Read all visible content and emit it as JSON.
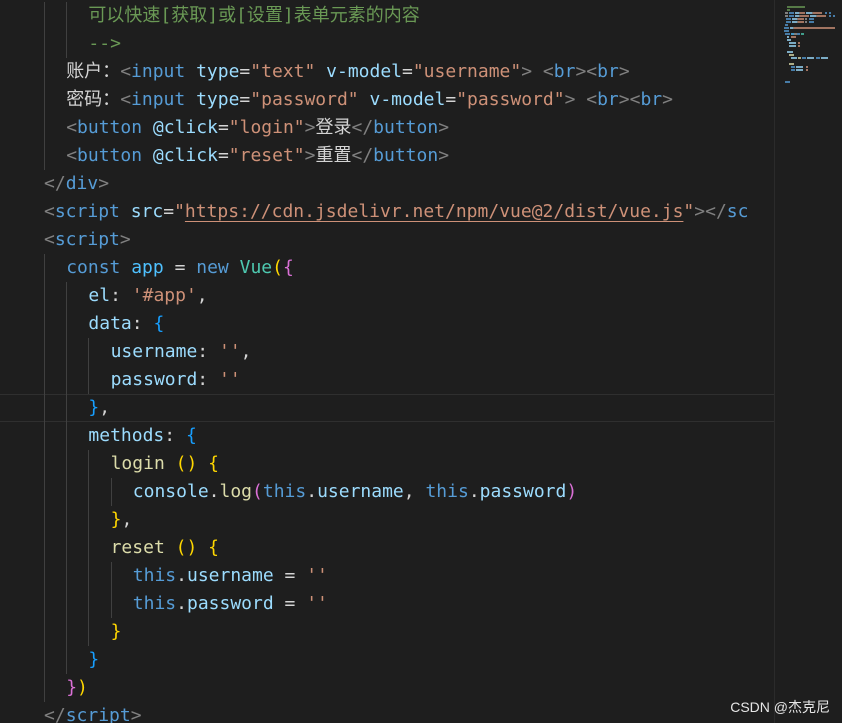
{
  "editor": {
    "current_line_index": 14,
    "lines": [
      {
        "indent": 2,
        "tokens": [
          [
            "comment",
            "可以快速[获取]或[设置]表单元素的内容"
          ]
        ]
      },
      {
        "indent": 2,
        "tokens": [
          [
            "comment",
            "-->"
          ]
        ]
      },
      {
        "indent": 1,
        "tokens": [
          [
            "text",
            "账户："
          ],
          [
            "bracket",
            "<"
          ],
          [
            "tag",
            "input"
          ],
          [
            "text",
            " "
          ],
          [
            "attr",
            "type"
          ],
          [
            "text",
            "="
          ],
          [
            "str",
            "\"text\""
          ],
          [
            "text",
            " "
          ],
          [
            "attr",
            "v-model"
          ],
          [
            "text",
            "="
          ],
          [
            "str",
            "\"username\""
          ],
          [
            "bracket",
            ">"
          ],
          [
            "text",
            " "
          ],
          [
            "bracket",
            "<"
          ],
          [
            "tag",
            "br"
          ],
          [
            "bracket",
            "><"
          ],
          [
            "tag",
            "br"
          ],
          [
            "bracket",
            ">"
          ]
        ]
      },
      {
        "indent": 1,
        "tokens": [
          [
            "text",
            "密码："
          ],
          [
            "bracket",
            "<"
          ],
          [
            "tag",
            "input"
          ],
          [
            "text",
            " "
          ],
          [
            "attr",
            "type"
          ],
          [
            "text",
            "="
          ],
          [
            "str",
            "\"password\""
          ],
          [
            "text",
            " "
          ],
          [
            "attr",
            "v-model"
          ],
          [
            "text",
            "="
          ],
          [
            "str",
            "\"password\""
          ],
          [
            "bracket",
            ">"
          ],
          [
            "text",
            " "
          ],
          [
            "bracket",
            "<"
          ],
          [
            "tag",
            "br"
          ],
          [
            "bracket",
            "><"
          ],
          [
            "tag",
            "br"
          ],
          [
            "bracket",
            ">"
          ]
        ]
      },
      {
        "indent": 1,
        "tokens": [
          [
            "bracket",
            "<"
          ],
          [
            "tag",
            "button"
          ],
          [
            "text",
            " "
          ],
          [
            "attr",
            "@click"
          ],
          [
            "text",
            "="
          ],
          [
            "str",
            "\"login\""
          ],
          [
            "bracket",
            ">"
          ],
          [
            "text",
            "登录"
          ],
          [
            "bracket",
            "</"
          ],
          [
            "tag",
            "button"
          ],
          [
            "bracket",
            ">"
          ]
        ]
      },
      {
        "indent": 1,
        "tokens": [
          [
            "bracket",
            "<"
          ],
          [
            "tag",
            "button"
          ],
          [
            "text",
            " "
          ],
          [
            "attr",
            "@click"
          ],
          [
            "text",
            "="
          ],
          [
            "str",
            "\"reset\""
          ],
          [
            "bracket",
            ">"
          ],
          [
            "text",
            "重置"
          ],
          [
            "bracket",
            "</"
          ],
          [
            "tag",
            "button"
          ],
          [
            "bracket",
            ">"
          ]
        ]
      },
      {
        "indent": 0,
        "tokens": [
          [
            "bracket",
            "</"
          ],
          [
            "tag",
            "div"
          ],
          [
            "bracket",
            ">"
          ]
        ]
      },
      {
        "indent": 0,
        "tokens": [
          [
            "bracket",
            "<"
          ],
          [
            "tag",
            "script"
          ],
          [
            "text",
            " "
          ],
          [
            "attr",
            "src"
          ],
          [
            "text",
            "="
          ],
          [
            "str",
            "\""
          ],
          [
            "link",
            "https://cdn.jsdelivr.net/npm/vue@2/dist/vue.js"
          ],
          [
            "str",
            "\""
          ],
          [
            "bracket",
            "></"
          ],
          [
            "tag",
            "sc"
          ]
        ]
      },
      {
        "indent": 0,
        "tokens": [
          [
            "bracket",
            "<"
          ],
          [
            "tag",
            "script"
          ],
          [
            "bracket",
            ">"
          ]
        ]
      },
      {
        "indent": 1,
        "tokens": [
          [
            "kw",
            "const"
          ],
          [
            "text",
            " "
          ],
          [
            "var",
            "app"
          ],
          [
            "text",
            " = "
          ],
          [
            "kw",
            "new"
          ],
          [
            "text",
            " "
          ],
          [
            "class",
            "Vue"
          ],
          [
            "b1",
            "("
          ],
          [
            "b2",
            "{"
          ]
        ]
      },
      {
        "indent": 2,
        "tokens": [
          [
            "prop",
            "el"
          ],
          [
            "punct",
            ": "
          ],
          [
            "str",
            "'#app'"
          ],
          [
            "punct",
            ","
          ]
        ]
      },
      {
        "indent": 2,
        "tokens": [
          [
            "prop",
            "data"
          ],
          [
            "punct",
            ": "
          ],
          [
            "b3",
            "{"
          ]
        ]
      },
      {
        "indent": 3,
        "tokens": [
          [
            "prop",
            "username"
          ],
          [
            "punct",
            ": "
          ],
          [
            "str",
            "''"
          ],
          [
            "punct",
            ","
          ]
        ]
      },
      {
        "indent": 3,
        "tokens": [
          [
            "prop",
            "password"
          ],
          [
            "punct",
            ": "
          ],
          [
            "str",
            "''"
          ]
        ]
      },
      {
        "indent": 2,
        "tokens": [
          [
            "b3",
            "}"
          ],
          [
            "punct",
            ","
          ]
        ]
      },
      {
        "indent": 2,
        "tokens": [
          [
            "prop",
            "methods"
          ],
          [
            "punct",
            ": "
          ],
          [
            "b3",
            "{"
          ]
        ]
      },
      {
        "indent": 3,
        "tokens": [
          [
            "fn",
            "login"
          ],
          [
            "text",
            " "
          ],
          [
            "b1",
            "()"
          ],
          [
            "text",
            " "
          ],
          [
            "b1",
            "{"
          ]
        ]
      },
      {
        "indent": 4,
        "tokens": [
          [
            "prop",
            "console"
          ],
          [
            "punct",
            "."
          ],
          [
            "fn",
            "log"
          ],
          [
            "b2",
            "("
          ],
          [
            "kw",
            "this"
          ],
          [
            "punct",
            "."
          ],
          [
            "prop",
            "username"
          ],
          [
            "punct",
            ", "
          ],
          [
            "kw",
            "this"
          ],
          [
            "punct",
            "."
          ],
          [
            "prop",
            "password"
          ],
          [
            "b2",
            ")"
          ]
        ]
      },
      {
        "indent": 3,
        "tokens": [
          [
            "b1",
            "}"
          ],
          [
            "punct",
            ","
          ]
        ]
      },
      {
        "indent": 3,
        "tokens": [
          [
            "fn",
            "reset"
          ],
          [
            "text",
            " "
          ],
          [
            "b1",
            "()"
          ],
          [
            "text",
            " "
          ],
          [
            "b1",
            "{"
          ]
        ]
      },
      {
        "indent": 4,
        "tokens": [
          [
            "kw",
            "this"
          ],
          [
            "punct",
            "."
          ],
          [
            "prop",
            "username"
          ],
          [
            "punct",
            " = "
          ],
          [
            "str",
            "''"
          ]
        ]
      },
      {
        "indent": 4,
        "tokens": [
          [
            "kw",
            "this"
          ],
          [
            "punct",
            "."
          ],
          [
            "prop",
            "password"
          ],
          [
            "punct",
            " = "
          ],
          [
            "str",
            "''"
          ]
        ]
      },
      {
        "indent": 3,
        "tokens": [
          [
            "b1",
            "}"
          ]
        ]
      },
      {
        "indent": 2,
        "tokens": [
          [
            "b3",
            "}"
          ]
        ]
      },
      {
        "indent": 1,
        "tokens": [
          [
            "b2",
            "}"
          ],
          [
            "b1",
            ")"
          ]
        ]
      },
      {
        "indent": 0,
        "tokens": [
          [
            "bracket",
            "</"
          ],
          [
            "tag",
            "script"
          ],
          [
            "bracket",
            ">"
          ]
        ]
      }
    ]
  },
  "watermark": "CSDN @杰克尼"
}
